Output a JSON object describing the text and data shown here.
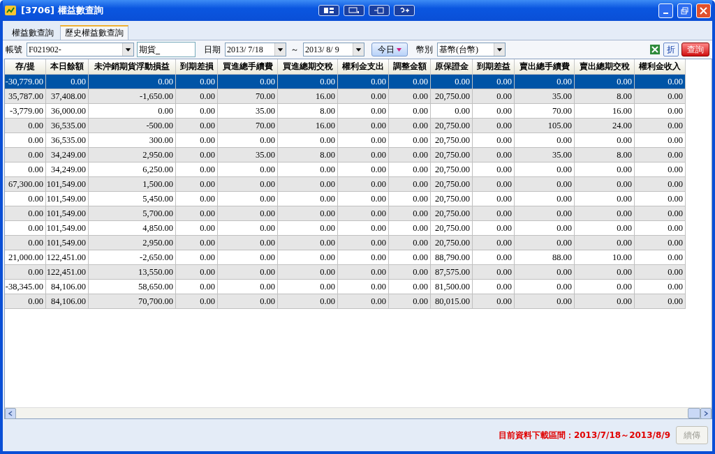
{
  "window": {
    "title": "[3706] 權益數查詢"
  },
  "tabs": [
    {
      "label": "權益數查詢",
      "selected": false
    },
    {
      "label": "歷史權益數查詢",
      "selected": true
    }
  ],
  "filters": {
    "account_label": "帳號",
    "account": "F021902-",
    "account_name": "期貨_",
    "date_label": "日期",
    "date_from": "2013/ 7/18",
    "date_sep": "～",
    "date_to": "2013/ 8/ 9",
    "today_button": "今日",
    "currency_label": "幣別",
    "currency": "基幣(台幣)",
    "fold_button": "折",
    "query_button": "查詢"
  },
  "table": {
    "columns": [
      "存/提",
      "本日餘額",
      "未沖銷期貨浮動損益",
      "到期差損",
      "買進總手續費",
      "買進總期交稅",
      "權利金支出",
      "調整金額",
      "原保證金",
      "到期差益",
      "賣出總手續費",
      "賣出總期交稅",
      "權利金收入"
    ],
    "rows": [
      {
        "selected": true,
        "cells": [
          "-30,779.00",
          "0.00",
          "0.00",
          "0.00",
          "0.00",
          "0.00",
          "0.00",
          "0.00",
          "0.00",
          "0.00",
          "0.00",
          "0.00",
          "0.00"
        ]
      },
      {
        "selected": false,
        "cells": [
          "35,787.00",
          "37,408.00",
          "-1,650.00",
          "0.00",
          "70.00",
          "16.00",
          "0.00",
          "0.00",
          "20,750.00",
          "0.00",
          "35.00",
          "8.00",
          "0.00"
        ]
      },
      {
        "selected": false,
        "cells": [
          "-3,779.00",
          "36,000.00",
          "0.00",
          "0.00",
          "35.00",
          "8.00",
          "0.00",
          "0.00",
          "0.00",
          "0.00",
          "70.00",
          "16.00",
          "0.00"
        ]
      },
      {
        "selected": false,
        "cells": [
          "0.00",
          "36,535.00",
          "-500.00",
          "0.00",
          "70.00",
          "16.00",
          "0.00",
          "0.00",
          "20,750.00",
          "0.00",
          "105.00",
          "24.00",
          "0.00"
        ]
      },
      {
        "selected": false,
        "cells": [
          "0.00",
          "36,535.00",
          "300.00",
          "0.00",
          "0.00",
          "0.00",
          "0.00",
          "0.00",
          "20,750.00",
          "0.00",
          "0.00",
          "0.00",
          "0.00"
        ]
      },
      {
        "selected": false,
        "cells": [
          "0.00",
          "34,249.00",
          "2,950.00",
          "0.00",
          "35.00",
          "8.00",
          "0.00",
          "0.00",
          "20,750.00",
          "0.00",
          "35.00",
          "8.00",
          "0.00"
        ]
      },
      {
        "selected": false,
        "cells": [
          "0.00",
          "34,249.00",
          "6,250.00",
          "0.00",
          "0.00",
          "0.00",
          "0.00",
          "0.00",
          "20,750.00",
          "0.00",
          "0.00",
          "0.00",
          "0.00"
        ]
      },
      {
        "selected": false,
        "cells": [
          "67,300.00",
          "101,549.00",
          "1,500.00",
          "0.00",
          "0.00",
          "0.00",
          "0.00",
          "0.00",
          "20,750.00",
          "0.00",
          "0.00",
          "0.00",
          "0.00"
        ]
      },
      {
        "selected": false,
        "cells": [
          "0.00",
          "101,549.00",
          "5,450.00",
          "0.00",
          "0.00",
          "0.00",
          "0.00",
          "0.00",
          "20,750.00",
          "0.00",
          "0.00",
          "0.00",
          "0.00"
        ]
      },
      {
        "selected": false,
        "cells": [
          "0.00",
          "101,549.00",
          "5,700.00",
          "0.00",
          "0.00",
          "0.00",
          "0.00",
          "0.00",
          "20,750.00",
          "0.00",
          "0.00",
          "0.00",
          "0.00"
        ]
      },
      {
        "selected": false,
        "cells": [
          "0.00",
          "101,549.00",
          "4,850.00",
          "0.00",
          "0.00",
          "0.00",
          "0.00",
          "0.00",
          "20,750.00",
          "0.00",
          "0.00",
          "0.00",
          "0.00"
        ]
      },
      {
        "selected": false,
        "cells": [
          "0.00",
          "101,549.00",
          "2,950.00",
          "0.00",
          "0.00",
          "0.00",
          "0.00",
          "0.00",
          "20,750.00",
          "0.00",
          "0.00",
          "0.00",
          "0.00"
        ]
      },
      {
        "selected": false,
        "cells": [
          "21,000.00",
          "122,451.00",
          "-2,650.00",
          "0.00",
          "0.00",
          "0.00",
          "0.00",
          "0.00",
          "88,790.00",
          "0.00",
          "88.00",
          "10.00",
          "0.00"
        ]
      },
      {
        "selected": false,
        "cells": [
          "0.00",
          "122,451.00",
          "13,550.00",
          "0.00",
          "0.00",
          "0.00",
          "0.00",
          "0.00",
          "87,575.00",
          "0.00",
          "0.00",
          "0.00",
          "0.00"
        ]
      },
      {
        "selected": false,
        "cells": [
          "-38,345.00",
          "84,106.00",
          "58,650.00",
          "0.00",
          "0.00",
          "0.00",
          "0.00",
          "0.00",
          "81,500.00",
          "0.00",
          "0.00",
          "0.00",
          "0.00"
        ]
      },
      {
        "selected": false,
        "cells": [
          "0.00",
          "84,106.00",
          "70,700.00",
          "0.00",
          "0.00",
          "0.00",
          "0.00",
          "0.00",
          "80,015.00",
          "0.00",
          "0.00",
          "0.00",
          "0.00"
        ]
      }
    ]
  },
  "status_bar": {
    "message": "目前資料下載區間：2013/7/18～2013/8/9",
    "resume_button": "續傳",
    "resume_disabled": true
  }
}
